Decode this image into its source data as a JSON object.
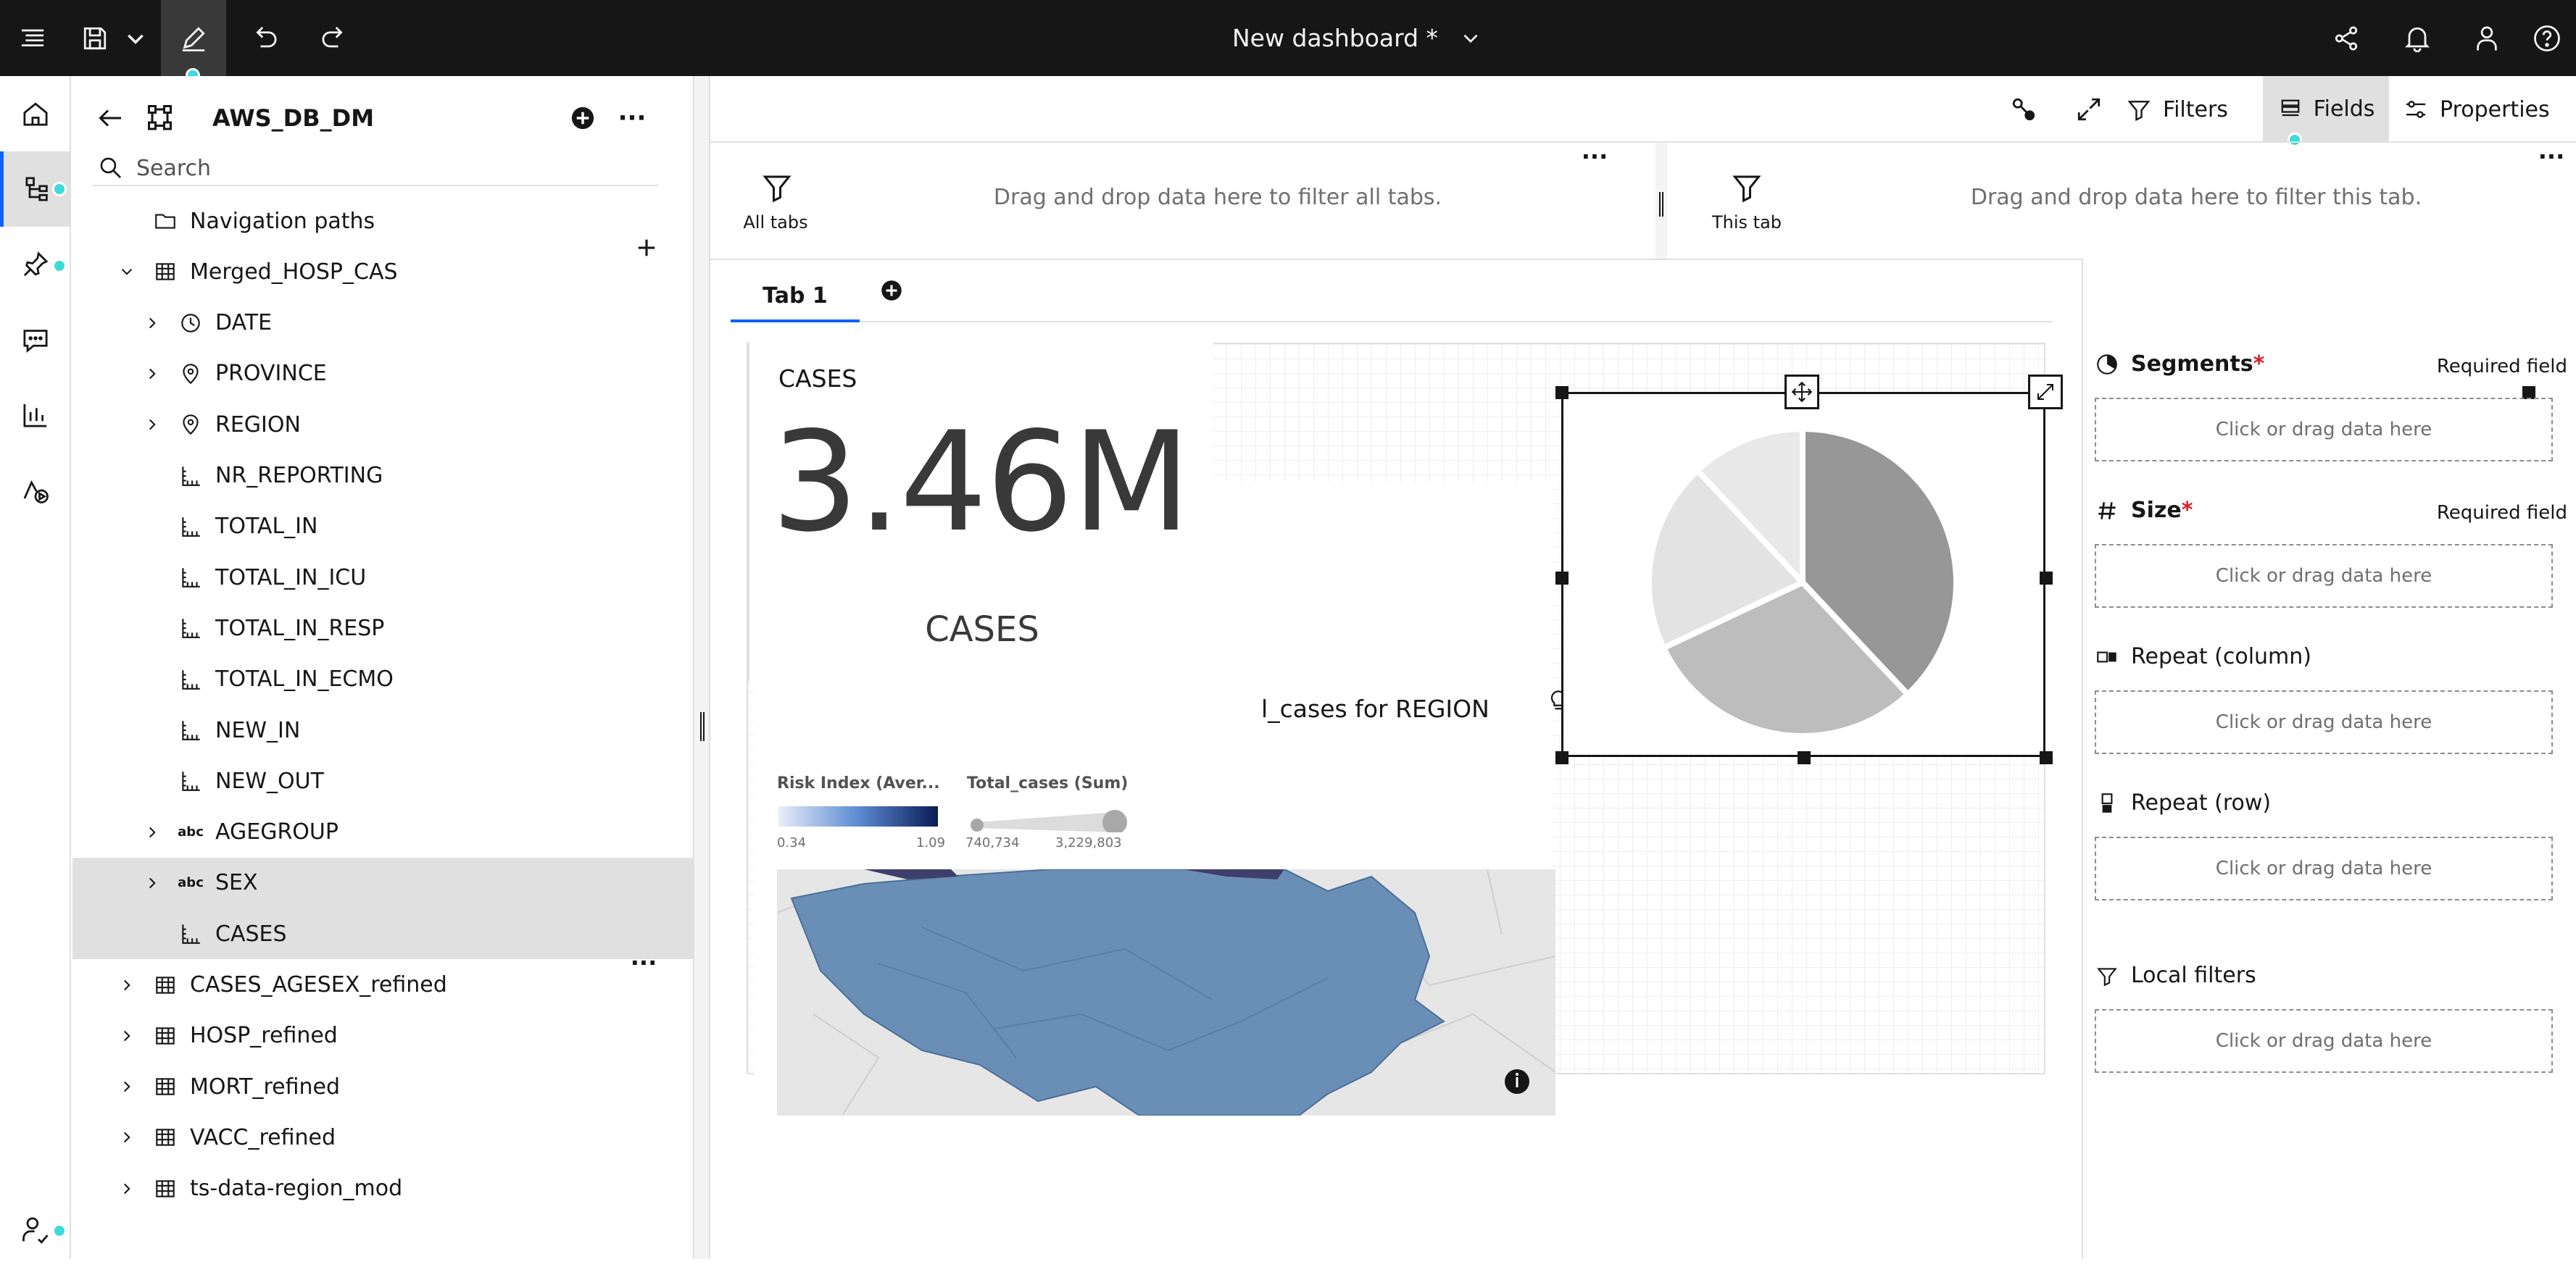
{
  "topbar": {
    "title": "New dashboard *",
    "icons": [
      "menu-icon",
      "save-icon",
      "chevron-down-icon",
      "edit-icon",
      "undo-icon",
      "redo-icon",
      "share-icon",
      "notification-icon",
      "user-icon",
      "help-icon"
    ]
  },
  "source_panel": {
    "source_name": "AWS_DB_DM",
    "search_placeholder": "Search",
    "items": [
      {
        "label": "Navigation paths",
        "icon": "folder-icon",
        "level": 0,
        "expandable": false
      },
      {
        "label": "Merged_HOSP_CAS",
        "icon": "table-icon",
        "level": 0,
        "expanded": true
      },
      {
        "label": "DATE",
        "icon": "clock-icon",
        "level": 1,
        "expandable": true
      },
      {
        "label": "PROVINCE",
        "icon": "location-icon",
        "level": 1,
        "expandable": true
      },
      {
        "label": "REGION",
        "icon": "location-icon",
        "level": 1,
        "expandable": true
      },
      {
        "label": "NR_REPORTING",
        "icon": "measure-icon",
        "level": 1
      },
      {
        "label": "TOTAL_IN",
        "icon": "measure-icon",
        "level": 1
      },
      {
        "label": "TOTAL_IN_ICU",
        "icon": "measure-icon",
        "level": 1
      },
      {
        "label": "TOTAL_IN_RESP",
        "icon": "measure-icon",
        "level": 1
      },
      {
        "label": "TOTAL_IN_ECMO",
        "icon": "measure-icon",
        "level": 1
      },
      {
        "label": "NEW_IN",
        "icon": "measure-icon",
        "level": 1
      },
      {
        "label": "NEW_OUT",
        "icon": "measure-icon",
        "level": 1
      },
      {
        "label": "AGEGROUP",
        "icon": "abc",
        "level": 1,
        "expandable": true
      },
      {
        "label": "SEX",
        "icon": "abc",
        "level": 1,
        "expandable": true,
        "selected": true
      },
      {
        "label": "CASES",
        "icon": "measure-icon",
        "level": 1,
        "selected": true
      },
      {
        "label": "CASES_AGESEX_refined",
        "icon": "table-icon",
        "level": 0,
        "expandable": true
      },
      {
        "label": "HOSP_refined",
        "icon": "table-icon",
        "level": 0,
        "expandable": true
      },
      {
        "label": "MORT_refined",
        "icon": "table-icon",
        "level": 0,
        "expandable": true
      },
      {
        "label": "VACC_refined",
        "icon": "table-icon",
        "level": 0,
        "expandable": true
      },
      {
        "label": "ts-data-region_mod",
        "icon": "table-icon",
        "level": 0,
        "expandable": true
      }
    ],
    "abc_label": "abc"
  },
  "toolbar": {
    "filters_label": "Filters",
    "fields_label": "Fields",
    "properties_label": "Properties"
  },
  "filter_bar": {
    "all_tabs_label": "All tabs",
    "all_tabs_hint": "Drag and drop data here to filter all tabs.",
    "this_tab_label": "This tab",
    "this_tab_hint": "Drag and drop data here to filter this tab."
  },
  "tabs": [
    {
      "label": "Tab 1",
      "active": true
    }
  ],
  "kpi": {
    "title": "CASES",
    "value": "3.46M",
    "caption": "CASES"
  },
  "map": {
    "partial_title": "l_cases for REGION",
    "legend_color_title": "Risk Index (Aver...",
    "legend_color_min": "0.34",
    "legend_color_max": "1.09",
    "legend_size_title": "Total_cases (Sum)",
    "legend_size_min": "740,734",
    "legend_size_max": "3,229,803",
    "region_color": "#6a8fb7"
  },
  "pie": {
    "slices": [
      0.38,
      0.3,
      0.2,
      0.12
    ],
    "colors": [
      "#979797",
      "#bdbdbd",
      "#e3e3e3",
      "#e8e8e8"
    ]
  },
  "fields_panel": {
    "slots": [
      {
        "label": "Segments",
        "required": true,
        "required_text": "Required field",
        "placeholder": "Click or drag data here",
        "icon": "pie-icon"
      },
      {
        "label": "Size",
        "required": true,
        "required_text": "Required field",
        "placeholder": "Click or drag data here",
        "icon": "hash-icon"
      },
      {
        "label": "Repeat (column)",
        "required": false,
        "placeholder": "Click or drag data here",
        "icon": "repeat-column-icon"
      },
      {
        "label": "Repeat (row)",
        "required": false,
        "placeholder": "Click or drag data here",
        "icon": "repeat-row-icon"
      },
      {
        "label": "Local filters",
        "required": false,
        "placeholder": "Click or drag data here",
        "icon": "filter-icon"
      }
    ],
    "required_marker": "*"
  }
}
